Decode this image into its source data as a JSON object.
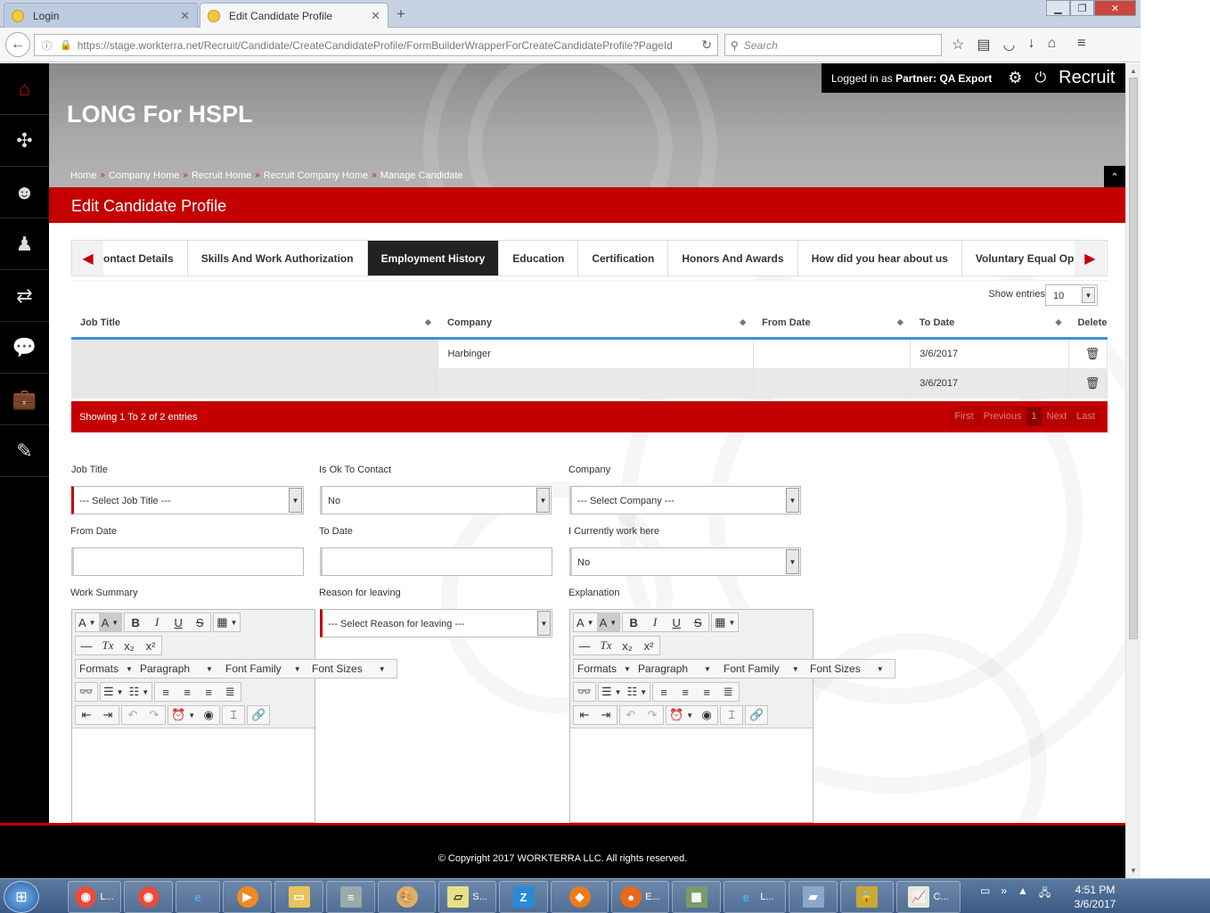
{
  "browser": {
    "tabs": [
      {
        "label": "Login",
        "active": false
      },
      {
        "label": "Edit Candidate Profile",
        "active": true
      }
    ],
    "url": "https://stage.workterra.net/Recruit/Candidate/CreateCandidateProfile/FormBuilderWrapperForCreateCandidateProfile?PageId",
    "search_placeholder": "Search"
  },
  "header": {
    "app_title": "LONG For HSPL",
    "logged_in_prefix": "Logged in as",
    "logged_in_role": "Partner:",
    "logged_in_user": "QA Export",
    "module": "Recruit",
    "breadcrumb": [
      "Home",
      "Company Home",
      "Recruit Home",
      "Recruit Company Home",
      "Manage Candidate"
    ]
  },
  "page_title": "Edit Candidate Profile",
  "tabs": [
    {
      "label": "ontact Details",
      "active": false
    },
    {
      "label": "Skills And Work Authorization",
      "active": false
    },
    {
      "label": "Employment History",
      "active": true
    },
    {
      "label": "Education",
      "active": false
    },
    {
      "label": "Certification",
      "active": false
    },
    {
      "label": "Honors And Awards",
      "active": false
    },
    {
      "label": "How did you hear about us",
      "active": false
    },
    {
      "label": "Voluntary Equal Opportu",
      "active": false
    }
  ],
  "table": {
    "show_entries_label": "Show entries",
    "page_size": "10",
    "columns": [
      "Job Title",
      "Company",
      "From Date",
      "To Date",
      "Delete"
    ],
    "rows": [
      [
        "",
        "Harbinger",
        "",
        "3/6/2017"
      ],
      [
        "",
        "",
        "",
        "3/6/2017"
      ]
    ],
    "info": "Showing 1 To 2 of 2 entries",
    "pager": {
      "first": "First",
      "previous": "Previous",
      "current": "1",
      "next": "Next",
      "last": "Last"
    }
  },
  "form": {
    "job_title": {
      "label": "Job Title",
      "value": "--- Select Job Title ---"
    },
    "ok_to_contact": {
      "label": "Is Ok To Contact",
      "value": "No"
    },
    "company": {
      "label": "Company",
      "value": "--- Select Company ---"
    },
    "from_date": {
      "label": "From Date",
      "value": ""
    },
    "to_date": {
      "label": "To Date",
      "value": ""
    },
    "currently_work": {
      "label": "I Currently work here",
      "value": "No"
    },
    "work_summary": {
      "label": "Work Summary"
    },
    "reason": {
      "label": "Reason for leaving",
      "value": "--- Select Reason for leaving ---"
    },
    "explanation": {
      "label": "Explanation"
    }
  },
  "editor_menu": {
    "formats": "Formats",
    "paragraph": "Paragraph",
    "font_family": "Font Family",
    "font_sizes": "Font Sizes"
  },
  "copyright": "© Copyright 2017 WORKTERRA LLC. All rights reserved.",
  "taskbar": {
    "items": [
      {
        "label": "L..."
      },
      {
        "label": ""
      },
      {
        "label": ""
      },
      {
        "label": ""
      },
      {
        "label": ""
      },
      {
        "label": ""
      },
      {
        "label": ""
      },
      {
        "label": "S..."
      },
      {
        "label": "Z"
      },
      {
        "label": ""
      },
      {
        "label": "E..."
      },
      {
        "label": ""
      },
      {
        "label": "L..."
      },
      {
        "label": ""
      },
      {
        "label": ""
      },
      {
        "label": "C..."
      }
    ],
    "time": "4:51 PM",
    "date": "3/6/2017"
  },
  "colors": {
    "brand_red": "#c40000",
    "sidebar": "#000000",
    "active_tab": "#222222",
    "sort_underline": "#3b8fd9"
  }
}
